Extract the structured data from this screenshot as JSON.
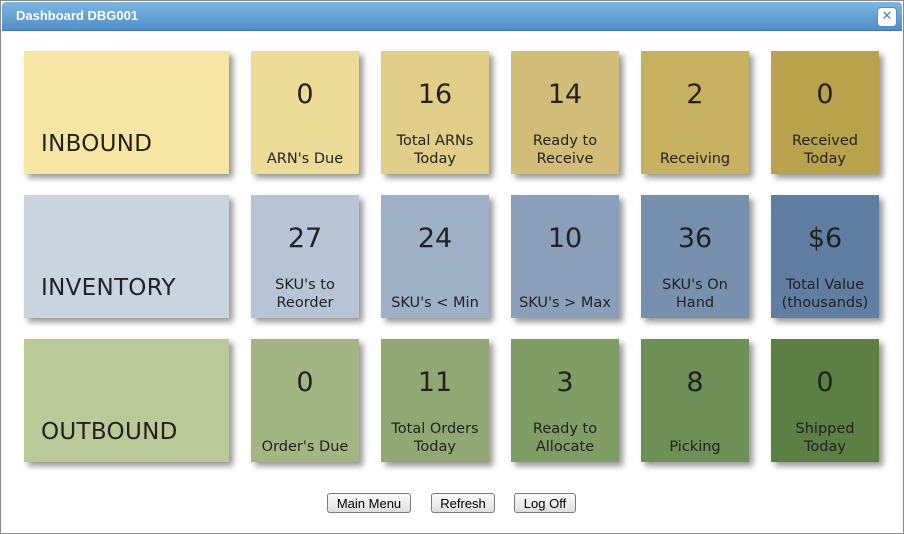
{
  "window": {
    "title": "Dashboard DBG001",
    "close_icon": "close-icon"
  },
  "rows": [
    {
      "id": "inbound",
      "label": "INBOUND",
      "label_color": "#f7e6a3",
      "tiles": [
        {
          "value": "0",
          "label": "ARN's Due",
          "color": "#eddc97"
        },
        {
          "value": "16",
          "label": "Total ARNs\nToday",
          "color": "#dfcd88"
        },
        {
          "value": "14",
          "label": "Ready to\nReceive",
          "color": "#d1bd77"
        },
        {
          "value": "2",
          "label": "Receiving",
          "color": "#c6b160"
        },
        {
          "value": "0",
          "label": "Received\nToday",
          "color": "#b8a24c"
        }
      ]
    },
    {
      "id": "inventory",
      "label": "INVENTORY",
      "label_color": "#cad4df",
      "tiles": [
        {
          "value": "27",
          "label": "SKU's to\nReorder",
          "color": "#b7c4d6"
        },
        {
          "value": "24",
          "label": "SKU's < Min",
          "color": "#9eb0c6"
        },
        {
          "value": "10",
          "label": "SKU's > Max",
          "color": "#8aa0ba"
        },
        {
          "value": "36",
          "label": "SKU's On\nHand",
          "color": "#7790ae"
        },
        {
          "value": "$6",
          "label": "Total Value\n(thousands)",
          "color": "#5f7ea1"
        }
      ]
    },
    {
      "id": "outbound",
      "label": "OUTBOUND",
      "label_color": "#bac998",
      "tiles": [
        {
          "value": "0",
          "label": "Order's Due",
          "color": "#a3b583"
        },
        {
          "value": "11",
          "label": "Total Orders\nToday",
          "color": "#91a874"
        },
        {
          "value": "3",
          "label": "Ready to\nAllocate",
          "color": "#809d66"
        },
        {
          "value": "8",
          "label": "Picking",
          "color": "#6e8f55"
        },
        {
          "value": "0",
          "label": "Shipped\nToday",
          "color": "#5c7f44"
        }
      ]
    }
  ],
  "footer": {
    "main_menu": "Main Menu",
    "refresh": "Refresh",
    "log_off": "Log Off"
  }
}
